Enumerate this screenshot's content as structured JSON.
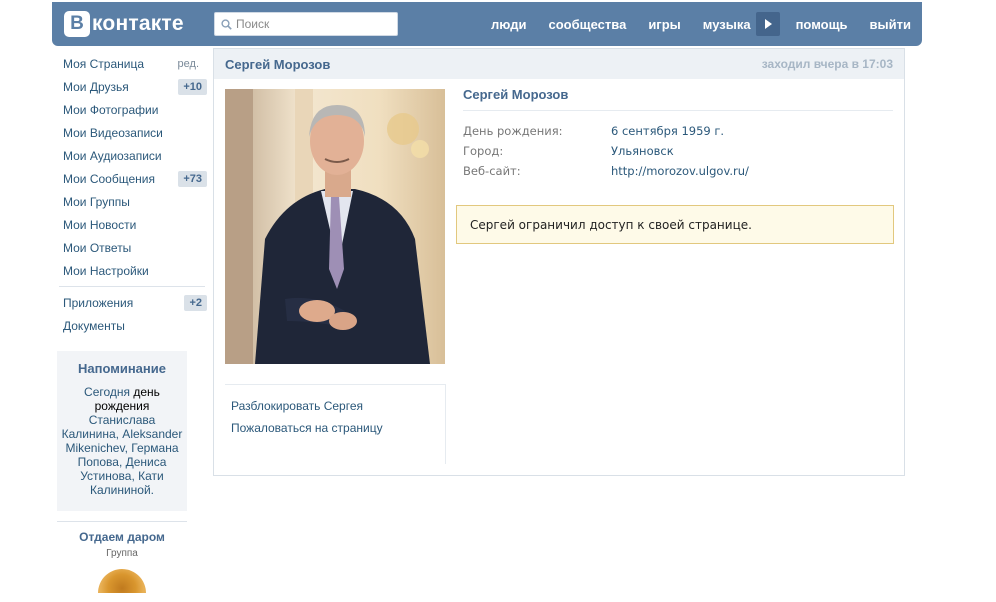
{
  "header": {
    "logo_letter": "В",
    "logo_text": "контакте",
    "search_placeholder": "Поиск",
    "nav": [
      "люди",
      "сообщества",
      "игры",
      "музыка",
      "помощь",
      "выйти"
    ]
  },
  "sidebar": {
    "items": [
      {
        "label": "Моя Страница",
        "extra": "ред."
      },
      {
        "label": "Мои Друзья",
        "badge": "+10"
      },
      {
        "label": "Мои Фотографии"
      },
      {
        "label": "Мои Видеозаписи"
      },
      {
        "label": "Мои Аудиозаписи"
      },
      {
        "label": "Мои Сообщения",
        "badge": "+73"
      },
      {
        "label": "Мои Группы"
      },
      {
        "label": "Мои Новости"
      },
      {
        "label": "Мои Ответы"
      },
      {
        "label": "Мои Настройки"
      }
    ],
    "extra_items": [
      {
        "label": "Приложения",
        "badge": "+2"
      },
      {
        "label": "Документы"
      }
    ],
    "reminder": {
      "title": "Напоминание",
      "text_before": "Сегодня ",
      "highlight": "день рождения",
      "text_after": " Станислава Калинина, Aleksander Mikenichev, Германа Попова, Дениса Устинова, Кати Калининой."
    },
    "gift": {
      "title": "Отдаем даром",
      "subtitle": "Группа"
    }
  },
  "profile": {
    "header_name": "Сергей Морозов",
    "last_seen": "заходил вчера в 17:03",
    "name": "Сергей Морозов",
    "fields": [
      {
        "key": "День рождения:",
        "value": "6 сентября 1959 г."
      },
      {
        "key": "Город:",
        "value": "Ульяновск"
      },
      {
        "key": "Веб-сайт:",
        "value": "http://morozov.ulgov.ru/"
      }
    ],
    "restricted_notice": "Сергей ограничил доступ к своей странице.",
    "actions": [
      "Разблокировать Сергея",
      "Пожаловаться на страницу"
    ]
  },
  "colors": {
    "header_bg": "#5b7fa6",
    "link": "#2b587a",
    "notice_bg": "#fefae8",
    "notice_border": "#e2c87e"
  }
}
